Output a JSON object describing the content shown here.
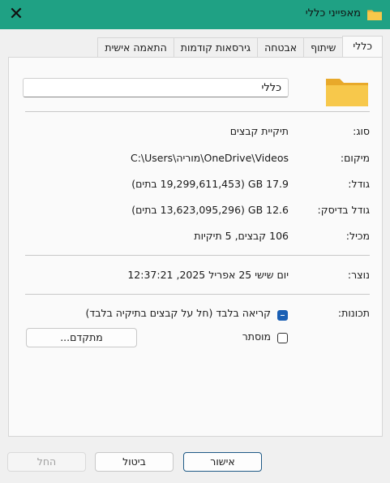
{
  "window": {
    "title": "מאפייני כללי",
    "close_glyph": "✕"
  },
  "tabs": [
    "כללי",
    "שיתוף",
    "אבטחה",
    "גירסאות קודמות",
    "התאמה אישית"
  ],
  "general": {
    "name_value": "כללי",
    "rows": [
      {
        "label": "סוג:",
        "value": "תיקיית קבצים"
      },
      {
        "label": "מיקום:",
        "value": "C:\\Users\\מוריה\\OneDrive\\Videos"
      },
      {
        "label": "גודל:",
        "value": "17.9 GB (19,299,611,453 בתים)"
      },
      {
        "label": "גודל בדיסק:",
        "value": "12.6 GB (13,623,095,296 בתים)"
      },
      {
        "label": "מכיל:",
        "value": "106 קבצים, 5 תיקיות"
      },
      {
        "label": "נוצר:",
        "value": "יום שישי 25 אפריל 2025, 12:37:21"
      }
    ],
    "attributes_label": "תכונות:",
    "readonly_label": "קריאה בלבד (חל על קבצים בתיקיה בלבד)",
    "readonly_state": "mixed",
    "hidden_label": "מוסתר",
    "hidden_checked": false,
    "advanced_button": "מתקדם..."
  },
  "footer": {
    "ok": "אישור",
    "cancel": "ביטול",
    "apply": "החל"
  },
  "colors": {
    "titlebar": "#1fa184",
    "folder": "#f7c84b",
    "accent": "#1a5fb4"
  }
}
